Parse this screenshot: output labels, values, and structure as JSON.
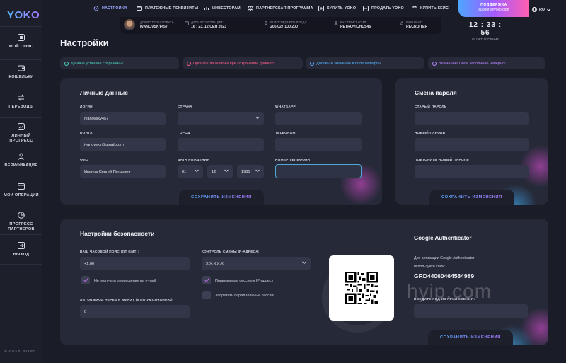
{
  "brand": {
    "logo": "YOKO"
  },
  "sidebar": {
    "items": [
      {
        "label": "МОЙ ОФИС",
        "icon": "grid-icon"
      },
      {
        "label": "КОШЕЛЬКИ",
        "icon": "wallet-icon"
      },
      {
        "label": "ПЕРЕВОДЫ",
        "icon": "transfer-icon"
      },
      {
        "label": "ЛИЧНЫЙ ПРОГРЕСС",
        "icon": "chart-icon"
      },
      {
        "label": "ВЕРИФИКАЦИЯ",
        "icon": "user-icon"
      },
      {
        "label": "МОИ ОПЕРАЦИИ",
        "icon": "calendar-icon"
      },
      {
        "label": "ПРОГРЕСС ПАРТНЕРОВ",
        "icon": "pie-icon"
      },
      {
        "label": "ВЫХОД",
        "icon": "logout-icon"
      }
    ],
    "copyright": "© 2023 YOKO Inc."
  },
  "topnav": {
    "items": [
      {
        "label": "НАСТРОЙКИ",
        "icon": "gear-icon",
        "active": true
      },
      {
        "label": "ПЛАТЕЖНЫЕ РЕКВИЗИТЫ",
        "icon": "card-icon"
      },
      {
        "label": "ИНВЕСТОРАМ",
        "icon": "chart-icon"
      },
      {
        "label": "ПАРТНЕРСКАЯ ПРОГРАММА",
        "icon": "people-icon"
      },
      {
        "label": "КУПИТЬ YOKO",
        "icon": "plus-icon"
      },
      {
        "label": "ПРОДАТЬ YOKO",
        "icon": "minus-icon"
      },
      {
        "label": "КУПИТЬ КЕЙС",
        "icon": "case-icon"
      }
    ],
    "support_title": "ПОДДЕРЖКА",
    "support_email": "support@yoko.com",
    "language": "RU"
  },
  "infobar": {
    "welcome_label": "ДОБРО ПОЖАЛОВАТЬ,",
    "welcome_value": "IVANOVSKY457",
    "reg_label": "ДАТА РЕГИСТРАЦИИ:",
    "reg_value": "16 : 23,  12 СЕН 2023",
    "ip_label": "IP ПОСЛЕДНЕГО ВХОДА:",
    "ip_value": "206.027.100.200",
    "invite_label": "ВАС ПРИГЛАСИЛ:",
    "invite_value": "PETROVICHUS45",
    "rank_label": "ВАШ РАНГ:",
    "rank_value": "RECRUITER"
  },
  "clock": {
    "time": "12 : 33 : 56",
    "date": "03 ОКТ, ВТОРНИК"
  },
  "page_title": "Настройки",
  "alerts": [
    {
      "text": "Данные успешно сохранены!",
      "color": "#4ad6c0"
    },
    {
      "text": "Произошла ошибка при сохранении данных!",
      "color": "#ff5f86"
    },
    {
      "text": "Добавьте значение в поле телефон!",
      "color": "#54b6ff"
    },
    {
      "text": "Внимание! Поле заполнено неверно!",
      "color": "#b987ff"
    }
  ],
  "personal": {
    "title": "Личные данные",
    "login_label": "ЛОГИН",
    "login_value": "Ivanovsky457",
    "email_label": "ПОЧТА",
    "email_value": "ivanovsky@gmail.com",
    "fio_label": "ФИО",
    "fio_value": "Иванов Сергей Петрович",
    "country_label": "СТРАНА",
    "city_label": "ГОРОД",
    "birth_label": "ДАТА РОЖДЕНИЯ",
    "birth_day": "01",
    "birth_month": "12",
    "birth_year": "1985",
    "whatsapp_label": "WHATSAPP",
    "telegram_label": "TELEGRAM",
    "phone_label": "НОМЕР ТЕЛЕФОНА",
    "save_label": "СОХРАНИТЬ ИЗМЕНЕНИЯ"
  },
  "password": {
    "title": "Смена пароля",
    "old_label": "СТАРЫЙ ПАРОЛЬ",
    "new_label": "НОВЫЙ ПАРОЛЬ",
    "repeat_label": "ПОВТОРИТЬ НОВЫЙ ПАРОЛЬ",
    "save_label": "СОХРАНИТЬ ИЗМЕНЕНИЯ"
  },
  "security": {
    "title": "Настройки безопасности",
    "tz_label": "ВАШ ЧАСОВОЙ ПОЯС (ОТ GMT):",
    "tz_value": "+1.00",
    "no_email_label": "Не получать оповещения на e-mail",
    "autologout_label": "АВТОВЫХОД ЧЕРЕЗ N МИНУТ (0 ПО УМОЛЧАНИЮ):",
    "autologout_value": "0",
    "ip_control_label": "КОНТРОЛЬ СМЕНЫ IP-АДРЕСА:",
    "ip_control_value": "X.X.X.X.X",
    "bind_ip_label": "Привязывать сессию к IP-адресу",
    "parallel_label": "Запретить параллельные сессии"
  },
  "google_auth": {
    "title": "Google Authenticator",
    "hint1": "Для активации Google Authenticator",
    "hint2": "используйте ключ:",
    "key": "GRD44060464584989",
    "code_label": "ВВЕДИТЕ КОД ИЗ ПРИЛОЖЕНИЯ:",
    "save_label": "СОХРАНИТЬ ИЗМЕНЕНИЯ"
  },
  "watermark": "hyip.com"
}
